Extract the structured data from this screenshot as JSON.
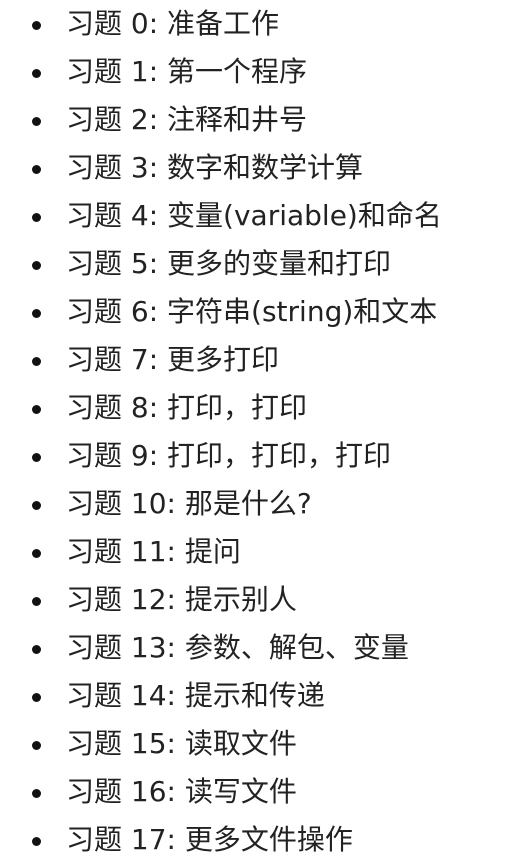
{
  "exercises": [
    "习题 0: 准备工作",
    "习题 1: 第一个程序",
    "习题 2: 注释和井号",
    "习题 3: 数字和数学计算",
    "习题 4: 变量(variable)和命名",
    "习题 5: 更多的变量和打印",
    "习题 6: 字符串(string)和文本",
    "习题 7: 更多打印",
    "习题 8: 打印，打印",
    "习题 9: 打印，打印，打印",
    "习题 10: 那是什么?",
    "习题 11: 提问",
    "习题 12: 提示别人",
    "习题 13: 参数、解包、变量",
    "习题 14: 提示和传递",
    "习题 15: 读取文件",
    "习题 16: 读写文件",
    "习题 17: 更多文件操作"
  ]
}
